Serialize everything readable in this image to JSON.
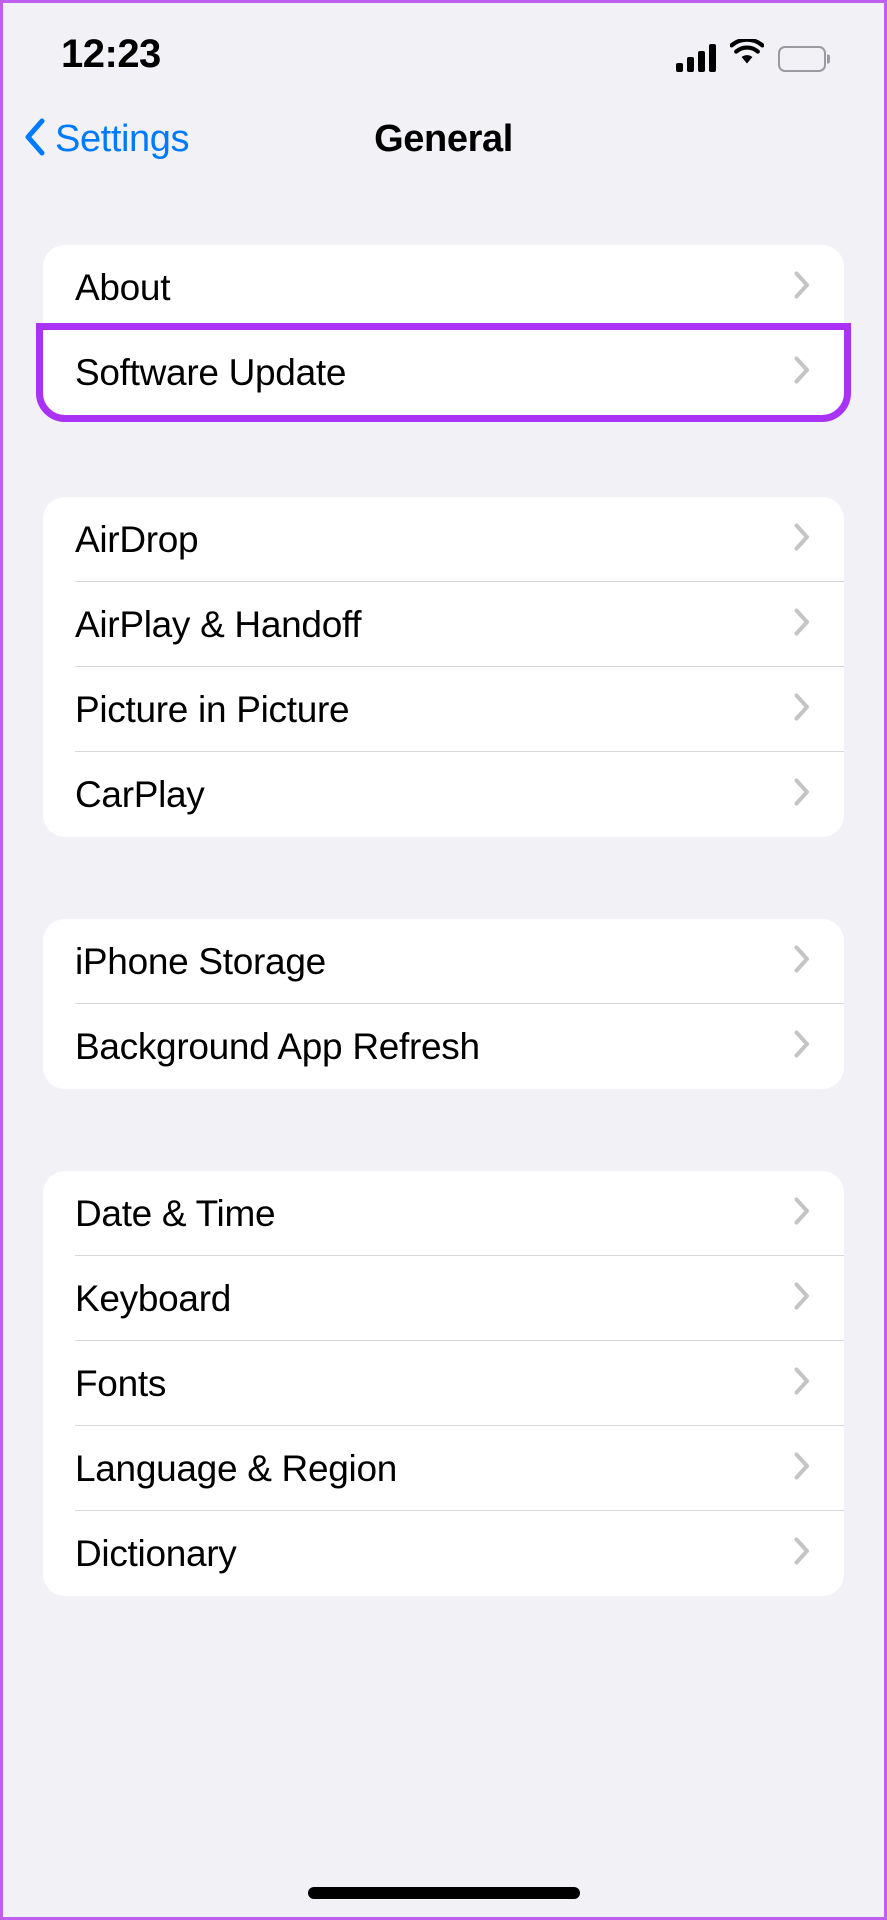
{
  "status_bar": {
    "time": "12:23",
    "cellular_icon": "cellular-signal-icon",
    "wifi_icon": "wifi-icon",
    "battery_icon": "battery-icon"
  },
  "nav": {
    "back_label": "Settings",
    "back_icon": "chevron-left-icon",
    "title": "General"
  },
  "colors": {
    "accent_blue": "#007AFF",
    "highlight_purple": "#A933F5",
    "page_background": "#F2F1F6",
    "card_background": "#FFFFFF",
    "separator": "#D8D8DC",
    "chevron_gray": "#C4C4C6"
  },
  "groups": [
    {
      "rows": [
        {
          "label": "About",
          "chevron": "chevron-right-icon",
          "highlighted": false
        },
        {
          "label": "Software Update",
          "chevron": "chevron-right-icon",
          "highlighted": true
        }
      ]
    },
    {
      "rows": [
        {
          "label": "AirDrop",
          "chevron": "chevron-right-icon",
          "highlighted": false
        },
        {
          "label": "AirPlay & Handoff",
          "chevron": "chevron-right-icon",
          "highlighted": false
        },
        {
          "label": "Picture in Picture",
          "chevron": "chevron-right-icon",
          "highlighted": false
        },
        {
          "label": "CarPlay",
          "chevron": "chevron-right-icon",
          "highlighted": false
        }
      ]
    },
    {
      "rows": [
        {
          "label": "iPhone Storage",
          "chevron": "chevron-right-icon",
          "highlighted": false
        },
        {
          "label": "Background App Refresh",
          "chevron": "chevron-right-icon",
          "highlighted": false
        }
      ]
    },
    {
      "rows": [
        {
          "label": "Date & Time",
          "chevron": "chevron-right-icon",
          "highlighted": false
        },
        {
          "label": "Keyboard",
          "chevron": "chevron-right-icon",
          "highlighted": false
        },
        {
          "label": "Fonts",
          "chevron": "chevron-right-icon",
          "highlighted": false
        },
        {
          "label": "Language & Region",
          "chevron": "chevron-right-icon",
          "highlighted": false
        },
        {
          "label": "Dictionary",
          "chevron": "chevron-right-icon",
          "highlighted": false
        }
      ]
    }
  ],
  "home_indicator": "home-indicator-bar"
}
